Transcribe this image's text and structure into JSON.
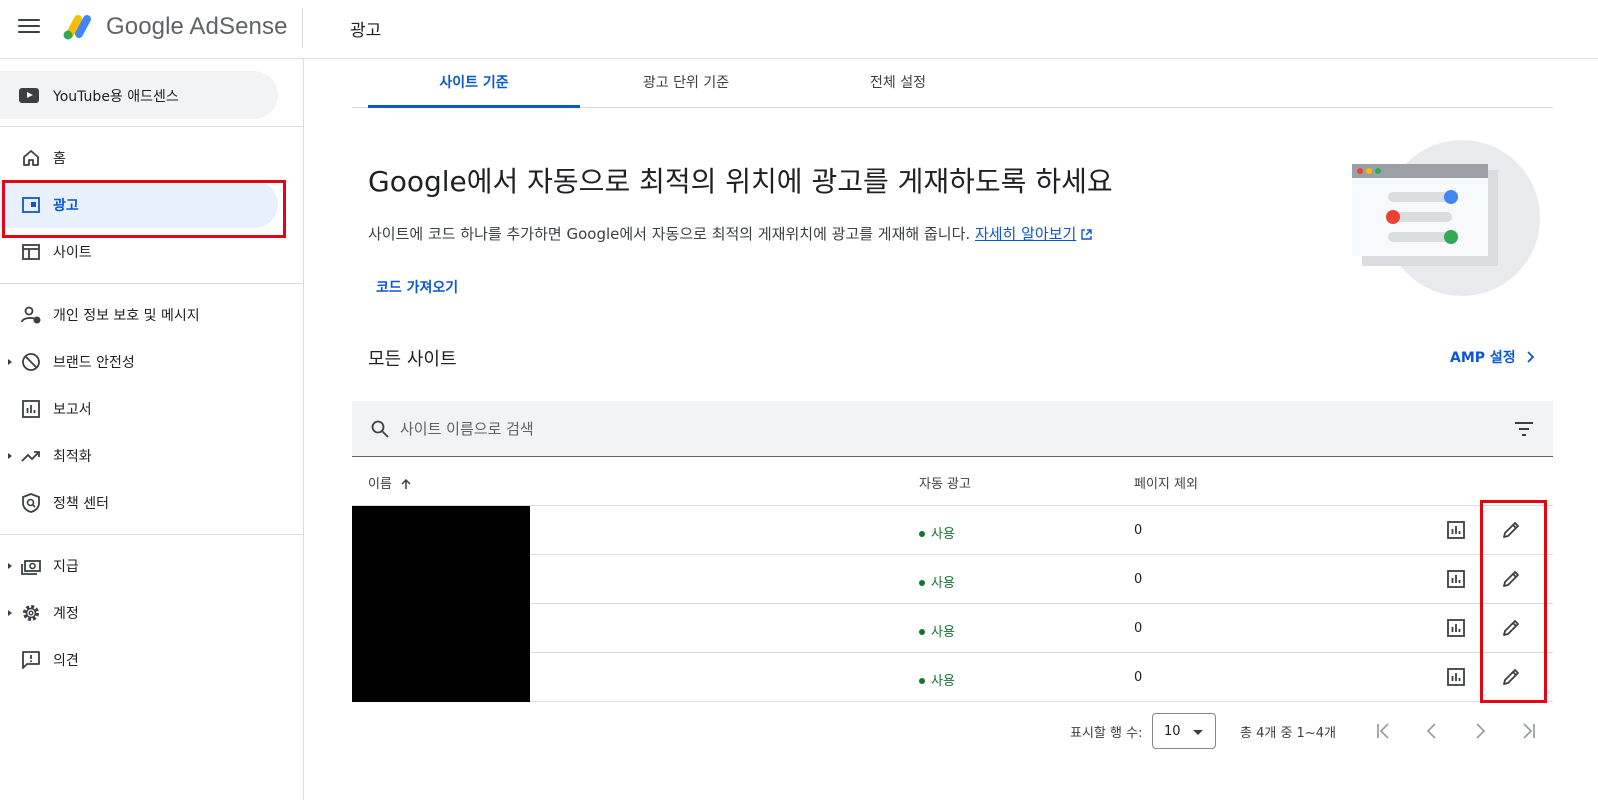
{
  "app": {
    "brand": "Google AdSense",
    "page_title": "광고"
  },
  "sidebar": {
    "youtube": "YouTube용 애드센스",
    "items": [
      {
        "label": "홈",
        "icon": "home-icon"
      },
      {
        "label": "광고",
        "icon": "ads-icon",
        "active": true
      },
      {
        "label": "사이트",
        "icon": "sites-icon"
      },
      {
        "label": "개인 정보 보호 및 메시지",
        "icon": "privacy-icon"
      },
      {
        "label": "브랜드 안전성",
        "icon": "block-icon"
      },
      {
        "label": "보고서",
        "icon": "report-icon"
      },
      {
        "label": "최적화",
        "icon": "trending-icon"
      },
      {
        "label": "정책 센터",
        "icon": "policy-icon"
      },
      {
        "label": "지급",
        "icon": "payments-icon"
      },
      {
        "label": "계정",
        "icon": "gear-icon"
      },
      {
        "label": "의견",
        "icon": "feedback-icon"
      }
    ]
  },
  "tabs": [
    {
      "label": "사이트 기준",
      "active": true
    },
    {
      "label": "광고 단위 기준"
    },
    {
      "label": "전체 설정"
    }
  ],
  "hero": {
    "title": "Google에서 자동으로 최적의 위치에 광고를 게재하도록 하세요",
    "description": "사이트에 코드 하나를 추가하면 Google에서 자동으로 최적의 게재위치에 광고를 게재해 줍니다.",
    "learn_more": "자세히 알아보기",
    "get_code": "코드 가져오기"
  },
  "sites": {
    "heading": "모든 사이트",
    "amp_link": "AMP 설정",
    "search_placeholder": "사이트 이름으로 검색",
    "columns": {
      "name": "이름",
      "auto_ads": "자동 광고",
      "page_exclusions": "페이지 제외"
    },
    "rows": [
      {
        "status": "사용",
        "exclusions": "0"
      },
      {
        "status": "사용",
        "exclusions": "0"
      },
      {
        "status": "사용",
        "exclusions": "0"
      },
      {
        "status": "사용",
        "exclusions": "0"
      }
    ]
  },
  "pagination": {
    "rows_label": "표시할 행 수:",
    "rows_value": "10",
    "range": "총 4개 중 1~4개"
  },
  "colors": {
    "accent": "#0b57d0",
    "active_bg": "#e8f0fe",
    "status_green": "#137333",
    "highlight_red": "#e30613"
  }
}
